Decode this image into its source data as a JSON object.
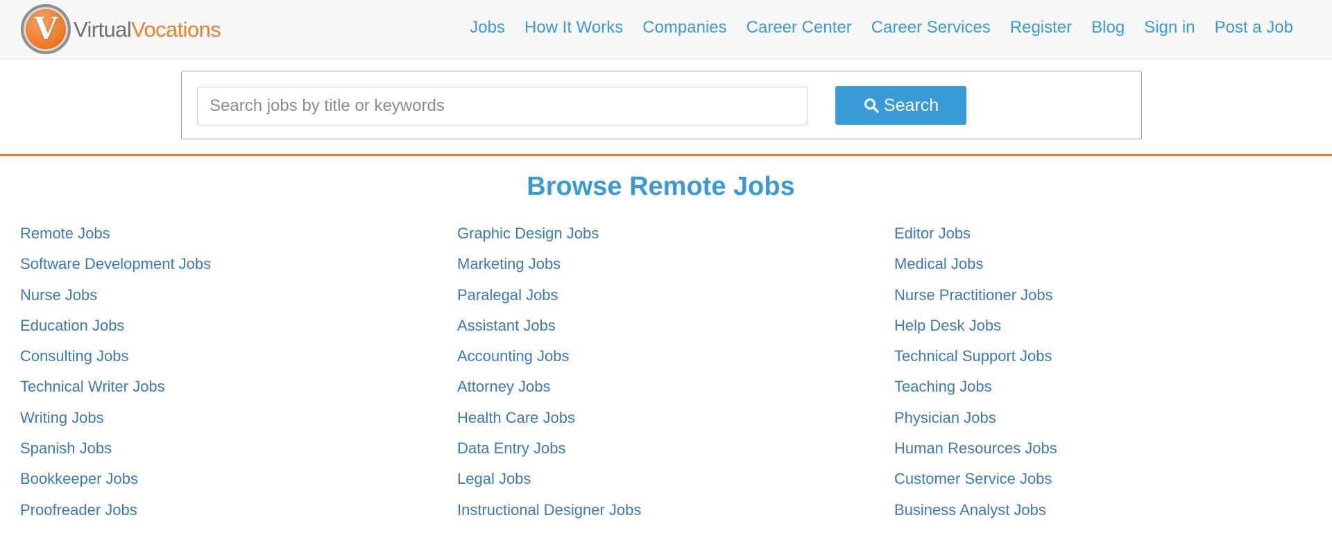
{
  "logo": {
    "letter": "V",
    "word1": "Virtual",
    "word2": "Vocations"
  },
  "nav": [
    "Jobs",
    "How It Works",
    "Companies",
    "Career Center",
    "Career Services",
    "Register",
    "Blog",
    "Sign in",
    "Post a Job"
  ],
  "search": {
    "placeholder": "Search jobs by title or keywords",
    "value": "",
    "button_label": "Search"
  },
  "browse_title": "Browse Remote Jobs",
  "columns": [
    [
      "Remote Jobs",
      "Software Development Jobs",
      "Nurse Jobs",
      "Education Jobs",
      "Consulting Jobs",
      "Technical Writer Jobs",
      "Writing Jobs",
      "Spanish Jobs",
      "Bookkeeper Jobs",
      "Proofreader Jobs"
    ],
    [
      "Graphic Design Jobs",
      "Marketing Jobs",
      "Paralegal Jobs",
      "Assistant Jobs",
      "Accounting Jobs",
      "Attorney Jobs",
      "Health Care Jobs",
      "Data Entry Jobs",
      "Legal Jobs",
      "Instructional Designer Jobs"
    ],
    [
      "Editor Jobs",
      "Medical Jobs",
      "Nurse Practitioner Jobs",
      "Help Desk Jobs",
      "Technical Support Jobs",
      "Teaching Jobs",
      "Physician Jobs",
      "Human Resources Jobs",
      "Customer Service Jobs",
      "Business Analyst Jobs"
    ]
  ],
  "colors": {
    "link": "#3a79b8",
    "accent": "#3a9ad9",
    "brand_orange": "#ee7d2f"
  }
}
